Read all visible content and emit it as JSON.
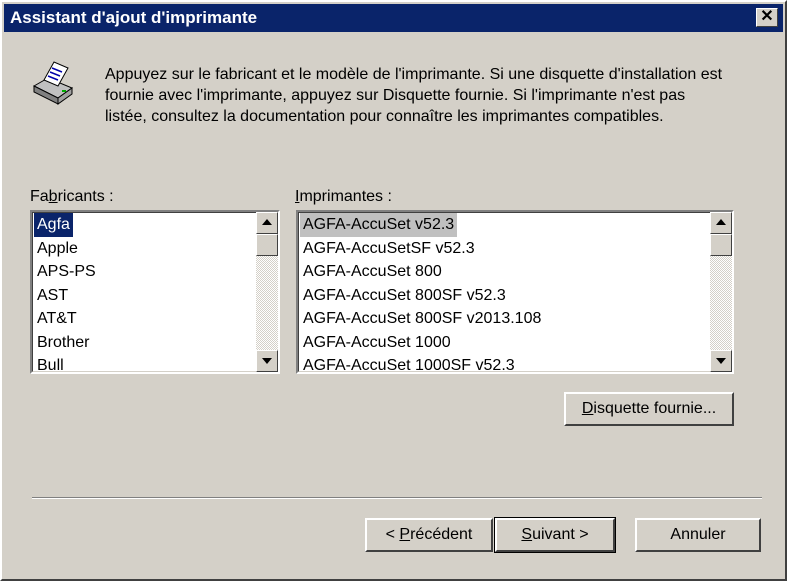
{
  "window": {
    "title": "Assistant d'ajout d'imprimante",
    "close_symbol": "✕"
  },
  "icon": "printer-icon",
  "description": "Appuyez sur le fabricant et le modèle de l'imprimante. Si une disquette d'installation est fournie avec l'imprimante, appuyez sur Disquette fournie. Si l'imprimante n'est pas listée, consultez la documentation pour connaître les imprimantes compatibles.",
  "manufacturers": {
    "label_pre": "Fa",
    "label_key": "b",
    "label_post": "ricants :",
    "items": [
      "Agfa",
      "Apple",
      "APS-PS",
      "AST",
      "AT&T",
      "Brother",
      "Bull"
    ],
    "selected": "Agfa"
  },
  "printers": {
    "label_pre": "",
    "label_key": "I",
    "label_post": "mprimantes :",
    "items": [
      "AGFA-AccuSet v52.3",
      "AGFA-AccuSetSF v52.3",
      "AGFA-AccuSet 800",
      "AGFA-AccuSet 800SF v52.3",
      "AGFA-AccuSet 800SF v2013.108",
      "AGFA-AccuSet 1000",
      "AGFA-AccuSet 1000SF v52.3"
    ],
    "selected": "AGFA-AccuSet v52.3"
  },
  "buttons": {
    "disk": {
      "key": "D",
      "rest": "isquette fournie..."
    },
    "back": {
      "pre": "< ",
      "key": "P",
      "rest": "récédent"
    },
    "next": {
      "key": "S",
      "rest": "uivant >"
    },
    "cancel": "Annuler"
  },
  "colors": {
    "titlebar": "#0a246a",
    "face": "#d4d0c8",
    "selection": "#0a246a"
  }
}
